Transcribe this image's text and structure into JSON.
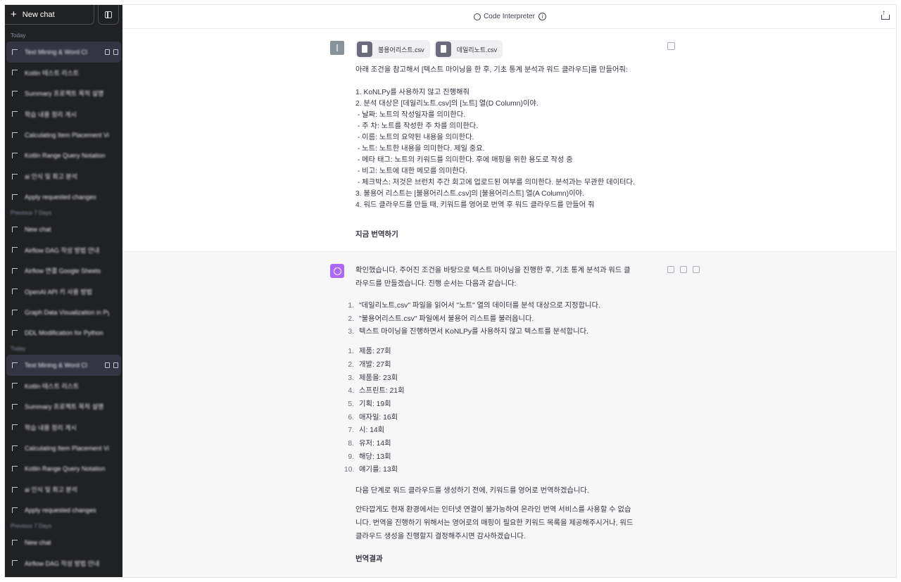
{
  "sidebar": {
    "new_chat_label": "New chat",
    "sections": [
      {
        "title": "Today",
        "items": [
          {
            "label": "Text Mining & Word Cl",
            "active": true
          },
          {
            "label": "Kotlin 테스트 리스트"
          },
          {
            "label": "Summary 프로젝트 목적 설명"
          },
          {
            "label": "학습 내용 정리 게시"
          },
          {
            "label": "Calculating Item Placement Vi"
          },
          {
            "label": "Kotlin Range Query Notation"
          },
          {
            "label": "ai 인식 및 회고 분석"
          },
          {
            "label": "Apply requested changes"
          }
        ]
      },
      {
        "title": "Previous 7 Days",
        "items": [
          {
            "label": "New chat"
          },
          {
            "label": "Airflow DAG 작성 방법 안내"
          },
          {
            "label": "Airflow 연결 Google Sheets"
          },
          {
            "label": "OpenAI API 키 사용 방법"
          },
          {
            "label": "Graph Data Visualization in Python"
          },
          {
            "label": "DDL Modification for Python"
          }
        ]
      },
      {
        "title": "Today",
        "items": [
          {
            "label": "Text Mining & Word Cl",
            "active": true
          },
          {
            "label": "Kotlin 테스트 리스트"
          },
          {
            "label": "Summary 프로젝트 목적 설명"
          },
          {
            "label": "학습 내용 정리 게시"
          },
          {
            "label": "Calculating Item Placement Vi"
          },
          {
            "label": "Kotlin Range Query Notation"
          },
          {
            "label": "ai 인식 및 회고 분석"
          },
          {
            "label": "Apply requested changes"
          }
        ]
      },
      {
        "title": "Previous 7 Days",
        "items": [
          {
            "label": "New chat"
          },
          {
            "label": "Airflow DAG 작성 방법 안내"
          }
        ]
      }
    ]
  },
  "topbar": {
    "mode_label": "Code Interpreter"
  },
  "user_message": {
    "files": [
      "불용어리스트.csv",
      "데일리노트.csv"
    ],
    "intro": "아래 조건을 참고해서 [텍스트 마이닝을 한 후, 기초 통계 분석과 워드 클라우드]를 만들어줘:",
    "lines": [
      "1. KoNLPy를 사용하지 않고 진행해줘",
      "2. 분석 대상은 [데일리노트.csv]의 [노트] 열(D Column)이야.",
      " - 날짜: 노트의 작성일자를 의미한다.",
      " - 주 차: 노트를 작성한 주 차를 의미한다.",
      " - 이름: 노트의 요약된 내용을 의미한다.",
      " - 노트: 노트한 내용을 의미한다. 제일 중요.",
      " - 메타 태그: 노트의 키워드를 의미한다. 후에 매핑을 위한 용도로 작성 중",
      " - 비고: 노트에 대한 메모를 의미한다.",
      " - 체크박스: 저것은 브런치 주간 회고에 업로드된 여부를 의미한다. 분석과는 무관한 데이터다.",
      "3. 불용어 리스트는 [불용어리스트.csv]의 [불용어리스트] 열(A Column)이야.",
      "4. 워드 클라우드를 만들 때, 키워드를 영어로 번역 후 워드 클라우드를 만들어 줘"
    ],
    "footer": "지금 번역하기"
  },
  "assistant_message": {
    "intro_1": "확인했습니다. 주어진 조건을 바탕으로 텍스트 마이닝을 진행한 후, 기초 통계 분석과 워드 클",
    "intro_2": "라우드를 만들겠습니다. 진행 순서는 다음과 같습니다:",
    "steps": [
      {
        "num": "1.",
        "text": "\"데일리노트.csv\" 파일을 읽어서 \"노트\" 열의 데이터를 분석 대상으로 지정합니다."
      },
      {
        "num": "2.",
        "text": "\"불용어리스트.csv\" 파일에서 불용어 리스트를 불러옵니다."
      },
      {
        "num": "3.",
        "text": "텍스트 마이닝을 진행하면서 KoNLPy를 사용하지 않고 텍스트를 분석합니다."
      }
    ],
    "keywords": [
      {
        "num": "1.",
        "text": "제품: 27회"
      },
      {
        "num": "2.",
        "text": "개발: 27회"
      },
      {
        "num": "3.",
        "text": "제품을: 23회"
      },
      {
        "num": "4.",
        "text": "스프린트: 21회"
      },
      {
        "num": "5.",
        "text": "기획: 19회"
      },
      {
        "num": "6.",
        "text": "애자일: 16회"
      },
      {
        "num": "7.",
        "text": "시: 14회"
      },
      {
        "num": "8.",
        "text": "유저: 14회"
      },
      {
        "num": "9.",
        "text": "해당: 13회"
      },
      {
        "num": "10.",
        "text": "얘기를: 13회"
      }
    ],
    "next_step": "다음 단계로 워드 클라우드를 생성하기 전에, 키워드를 영어로 번역하겠습니다.",
    "sorry_1": "안타깝게도 현재 환경에서는 인터넷 연결이 불가능하여 온라인 번역 서비스를 사용할 수 없습",
    "sorry_2": "니다. 번역을 진행하기 위해서는 영어로의 매핑이 필요한 키워드 목록을 제공해주시거나, 워드",
    "sorry_3": "클라우드 생성을 진행할지 결정해주시면 감사하겠습니다.",
    "footer": "번역결과"
  },
  "colors": {
    "sidebar_bg": "#202123",
    "assistant_bg": "#f7f7f8",
    "gpt_avatar": "#ab68ff"
  }
}
